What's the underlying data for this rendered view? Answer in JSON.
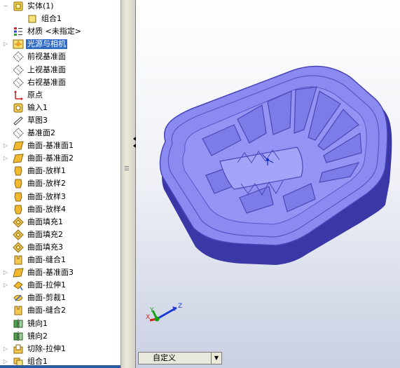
{
  "feature_tree": {
    "items": [
      {
        "label": "实体(1)",
        "icon": "folder-icon",
        "expander": "−"
      },
      {
        "label": "组合1",
        "icon": "solid-body-icon",
        "expander": ""
      },
      {
        "label": "材质 <未指定>",
        "icon": "material-icon",
        "expander": ""
      },
      {
        "label": "光源与相机",
        "icon": "lights-cameras-icon",
        "expander": "▷",
        "selected": true
      },
      {
        "label": "前视基准面",
        "icon": "plane-icon",
        "expander": ""
      },
      {
        "label": "上视基准面",
        "icon": "plane-icon",
        "expander": ""
      },
      {
        "label": "右视基准面",
        "icon": "plane-icon",
        "expander": ""
      },
      {
        "label": "原点",
        "icon": "origin-icon",
        "expander": ""
      },
      {
        "label": "输入1",
        "icon": "import-icon",
        "expander": ""
      },
      {
        "label": "草图3",
        "icon": "sketch-icon",
        "expander": ""
      },
      {
        "label": "基准面2",
        "icon": "plane-icon",
        "expander": ""
      },
      {
        "label": "曲面-基准面1",
        "icon": "planar-surface-icon",
        "expander": "▷"
      },
      {
        "label": "曲面-基准面2",
        "icon": "planar-surface-icon",
        "expander": "▷"
      },
      {
        "label": "曲面-放样1",
        "icon": "loft-surface-icon",
        "expander": ""
      },
      {
        "label": "曲面-放样2",
        "icon": "loft-surface-icon",
        "expander": ""
      },
      {
        "label": "曲面-放样3",
        "icon": "loft-surface-icon",
        "expander": ""
      },
      {
        "label": "曲面-放样4",
        "icon": "loft-surface-icon",
        "expander": ""
      },
      {
        "label": "曲面填充1",
        "icon": "fill-surface-icon",
        "expander": ""
      },
      {
        "label": "曲面填充2",
        "icon": "fill-surface-icon",
        "expander": ""
      },
      {
        "label": "曲面填充3",
        "icon": "fill-surface-icon",
        "expander": ""
      },
      {
        "label": "曲面-缝合1",
        "icon": "knit-surface-icon",
        "expander": ""
      },
      {
        "label": "曲面-基准面3",
        "icon": "planar-surface-icon",
        "expander": "▷"
      },
      {
        "label": "曲面-拉伸1",
        "icon": "extrude-surface-icon",
        "expander": "▷"
      },
      {
        "label": "曲面-剪裁1",
        "icon": "trim-surface-icon",
        "expander": ""
      },
      {
        "label": "曲面-缝合2",
        "icon": "knit-surface-icon",
        "expander": ""
      },
      {
        "label": "镜向1",
        "icon": "mirror-icon",
        "expander": ""
      },
      {
        "label": "镜向2",
        "icon": "mirror-icon",
        "expander": ""
      },
      {
        "label": "切除-拉伸1",
        "icon": "cut-extrude-icon",
        "expander": "▷"
      },
      {
        "label": "组合1",
        "icon": "combine-icon",
        "expander": "▷"
      }
    ]
  },
  "viewport": {
    "triad": {
      "x": "X",
      "y": "Y",
      "z": "Z"
    },
    "view_combo": "自定义",
    "combo_arrow": "▼",
    "model_color": "#8a8af0"
  },
  "colors": {
    "selection": "#3169c6",
    "panel_border": "#2a5aa0"
  }
}
